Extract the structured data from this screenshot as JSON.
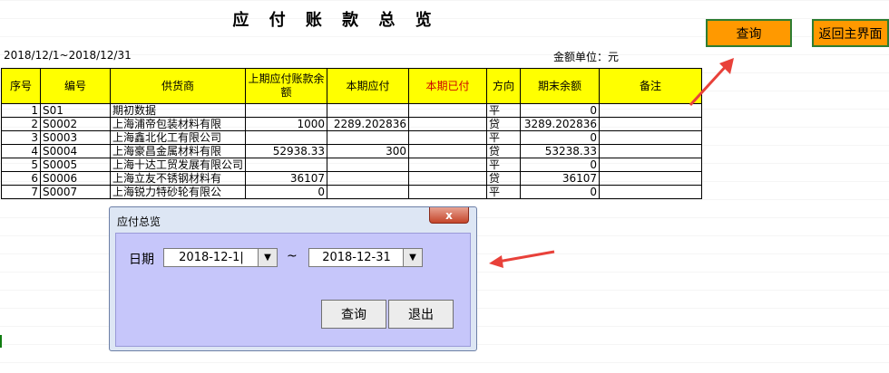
{
  "sheet": {
    "title": "应 付 账 款 总 览",
    "date_range": "2018/12/1~2018/12/31",
    "unit": "金额单位：元",
    "query_button": "查询",
    "home_button": "返回主界面",
    "headers": {
      "seq": "序号",
      "code": "编号",
      "supplier": "供货商",
      "prev_balance": "上期应付账款余额",
      "current_payable": "本期应付",
      "current_paid": "本期已付",
      "direction": "方向",
      "end_balance": "期末余额",
      "remark": "备注"
    },
    "rows": [
      {
        "seq": "1",
        "code": "S01",
        "supplier": "期初数据",
        "prev": "",
        "payable": "",
        "paid": "",
        "dir": "平",
        "end": "0",
        "remark": ""
      },
      {
        "seq": "2",
        "code": "S0002",
        "supplier": "上海浦帝包装材料有限",
        "prev": "1000",
        "payable": "2289.202836",
        "paid": "",
        "dir": "贷",
        "end": "3289.202836",
        "remark": ""
      },
      {
        "seq": "3",
        "code": "S0003",
        "supplier": "上海鑫北化工有限公司",
        "prev": "",
        "payable": "",
        "paid": "",
        "dir": "平",
        "end": "0",
        "remark": ""
      },
      {
        "seq": "4",
        "code": "S0004",
        "supplier": "上海豪昌金属材料有限",
        "prev": "52938.33",
        "payable": "300",
        "paid": "",
        "dir": "贷",
        "end": "53238.33",
        "remark": ""
      },
      {
        "seq": "5",
        "code": "S0005",
        "supplier": "上海十达工贸发展有限公司",
        "prev": "",
        "payable": "",
        "paid": "",
        "dir": "平",
        "end": "0",
        "remark": ""
      },
      {
        "seq": "6",
        "code": "S0006",
        "supplier": "上海立友不锈钢材料有",
        "prev": "36107",
        "payable": "",
        "paid": "",
        "dir": "贷",
        "end": "36107",
        "remark": ""
      },
      {
        "seq": "7",
        "code": "S0007",
        "supplier": "上海锐力特砂轮有限公",
        "prev": "0",
        "payable": "",
        "paid": "",
        "dir": "平",
        "end": "0",
        "remark": ""
      }
    ]
  },
  "dialog": {
    "title": "应付总览",
    "close_glyph": "x",
    "date_label": "日期",
    "start_date": "2018-12-1|",
    "end_date": "2018-12-31",
    "dropdown_glyph": "▼",
    "separator": "~",
    "query_button": "查询",
    "exit_button": "退出"
  },
  "colors": {
    "header_fill": "#ffff00",
    "button_fill": "#ff9900",
    "button_border": "#2e7d32",
    "dialog_body": "#c6c6fa",
    "arrow": "#e8413a",
    "paid_header_text": "#cc0000"
  }
}
